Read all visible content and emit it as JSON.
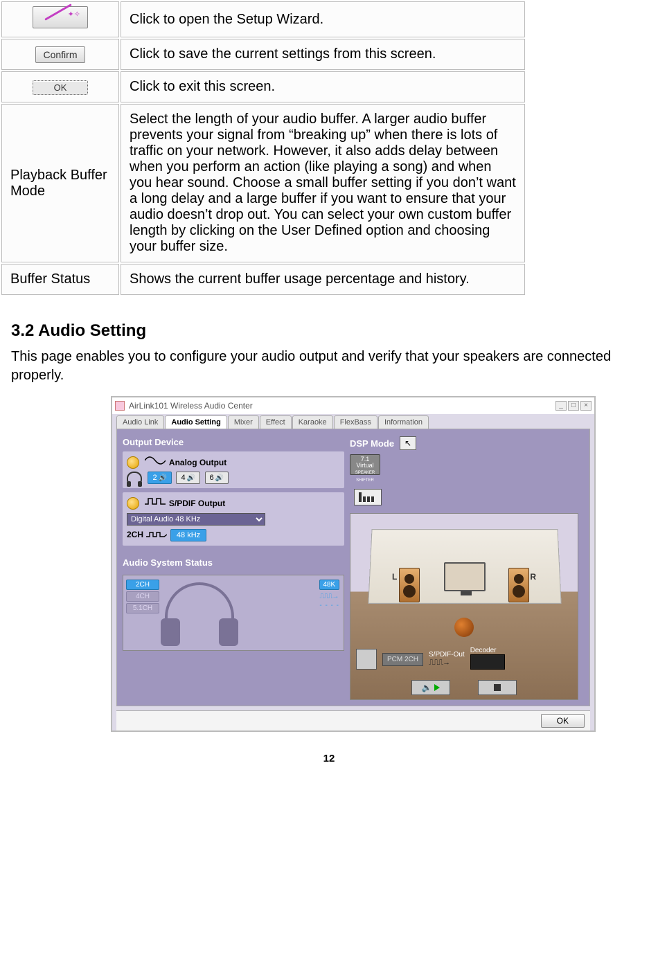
{
  "table": {
    "wizard_desc": "Click to open the Setup Wizard.",
    "confirm_label": "Confirm",
    "confirm_desc": "Click to save the current settings from this screen.",
    "ok_label": "OK",
    "ok_desc": "Click to exit this screen.",
    "playback_label": "Playback Buffer Mode",
    "playback_desc": "Select the length of your audio buffer. A larger audio buffer prevents your signal from “breaking up” when there is lots of traffic on your network. However, it also adds delay between when you perform an action (like playing a song) and when you hear sound. Choose a small buffer setting if you don’t want a long delay and a large buffer if you want to ensure that your audio doesn’t drop out. You can select your own custom buffer length by clicking on the User Defined option and choosing your buffer size.",
    "buffer_status_label": "Buffer Status",
    "buffer_status_desc": "Shows the current buffer usage percentage and history."
  },
  "section": {
    "heading": "3.2 Audio Setting",
    "intro": "This page enables you to configure your audio output and verify that your speakers are connected properly."
  },
  "app": {
    "title": "AirLink101 Wireless Audio Center",
    "tabs": [
      "Audio Link",
      "Audio Setting",
      "Mixer",
      "Effect",
      "Karaoke",
      "FlexBass",
      "Information"
    ],
    "active_tab_index": 1,
    "output_device": {
      "title": "Output Device",
      "analog_label": "Analog Output",
      "channels": [
        "2",
        "4",
        "6"
      ],
      "active_channel": "2",
      "spdif_label": "S/PDIF Output",
      "spdif_select": "Digital Audio 48 KHz",
      "spdif_ch_label": "2CH",
      "spdif_rate": "48 kHz"
    },
    "audio_status": {
      "title": "Audio System Status",
      "badges": [
        "2CH",
        "4CH",
        "5.1CH"
      ],
      "active_badge": "2CH",
      "rate_badge": "48K"
    },
    "dsp": {
      "title": "DSP Mode",
      "virtual_label_top": "7.1",
      "virtual_label_mid": "Virtual",
      "virtual_label_bot": "SPEAKER SHIFTER"
    },
    "room": {
      "l_label": "L",
      "r_label": "R",
      "pcm_label": "PCM 2CH",
      "spdif_out_label": "S/PDIF-Out",
      "decoder_label": "Decoder"
    },
    "footer_ok": "OK"
  },
  "page_number": "12"
}
